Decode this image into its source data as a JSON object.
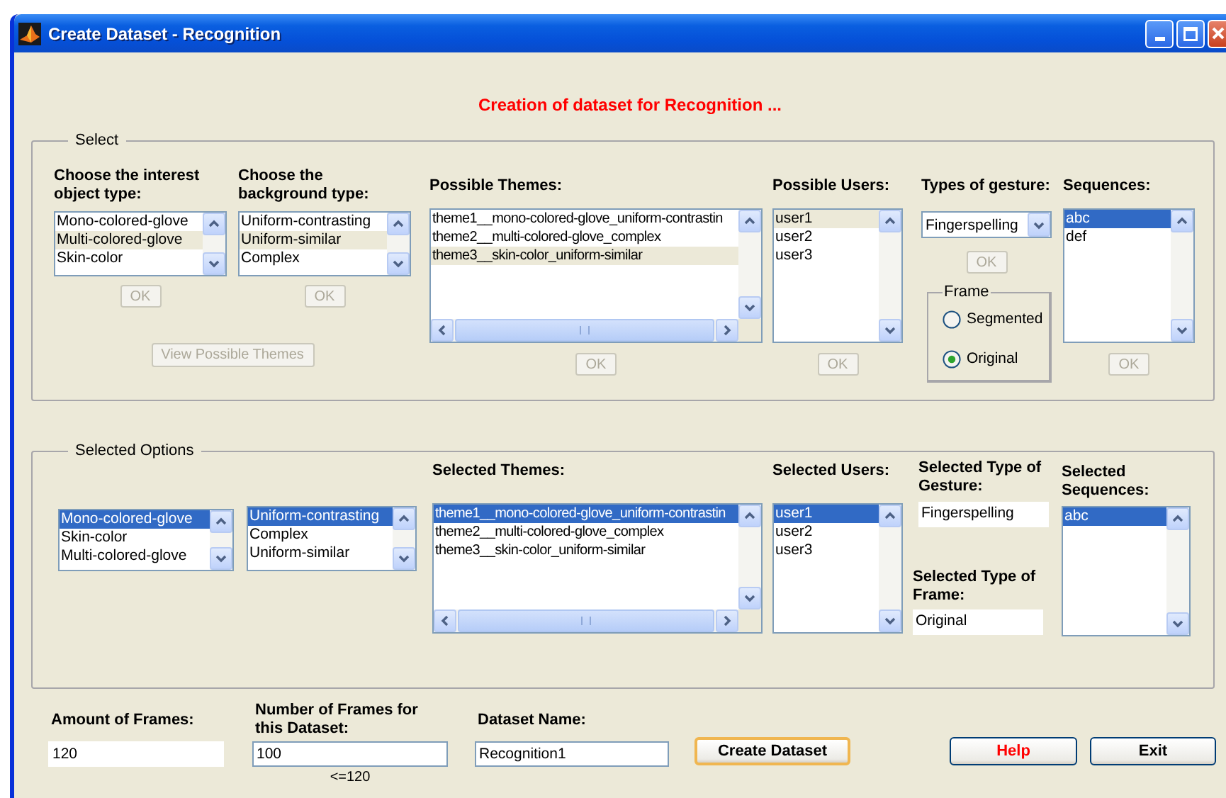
{
  "window": {
    "title": "Create Dataset - Recognition"
  },
  "heading": "Creation of dataset for Recognition  ...",
  "select_panel": {
    "title": "Select",
    "object_type": {
      "label": "Choose the interest object type:",
      "focused": false,
      "items": [
        {
          "text": "Mono-colored-glove",
          "selected": false
        },
        {
          "text": "Multi-colored-glove",
          "selected": true
        },
        {
          "text": "Skin-color",
          "selected": false
        }
      ],
      "ok": {
        "label": "OK",
        "disabled": true
      }
    },
    "background_type": {
      "label": "Choose the background type:",
      "focused": false,
      "items": [
        {
          "text": "Uniform-contrasting",
          "selected": false
        },
        {
          "text": "Uniform-similar",
          "selected": true
        },
        {
          "text": "Complex",
          "selected": false
        }
      ],
      "ok": {
        "label": "OK",
        "disabled": true
      }
    },
    "view_themes_button": {
      "label": "View Possible Themes",
      "disabled": true
    },
    "themes": {
      "label": "Possible Themes:",
      "focused": false,
      "items": [
        {
          "text": "theme1__mono-colored-glove_uniform-contrastin",
          "selected": false
        },
        {
          "text": "theme2__multi-colored-glove_complex",
          "selected": false
        },
        {
          "text": "theme3__skin-color_uniform-similar",
          "selected": true
        }
      ],
      "ok": {
        "label": "OK",
        "disabled": true
      }
    },
    "users": {
      "label": "Possible Users:",
      "focused": false,
      "items": [
        {
          "text": "user1",
          "selected": true
        },
        {
          "text": "user2",
          "selected": false
        },
        {
          "text": "user3",
          "selected": false
        }
      ],
      "ok": {
        "label": "OK",
        "disabled": true
      }
    },
    "gesture": {
      "label": "Types of gesture:",
      "value": "Fingerspelling",
      "ok": {
        "label": "OK",
        "disabled": true
      }
    },
    "frame": {
      "title": "Frame",
      "options": [
        {
          "label": "Segmented",
          "selected": false
        },
        {
          "label": "Original",
          "selected": true
        }
      ]
    },
    "sequences": {
      "label": "Sequences:",
      "focused": true,
      "items": [
        {
          "text": "abc",
          "selected": true
        },
        {
          "text": "def",
          "selected": false
        }
      ],
      "ok": {
        "label": "OK",
        "disabled": true
      }
    }
  },
  "selected_panel": {
    "title": "Selected Options",
    "object_type": {
      "focused": true,
      "items": [
        {
          "text": "Mono-colored-glove",
          "selected": true
        },
        {
          "text": "Skin-color",
          "selected": false
        },
        {
          "text": "Multi-colored-glove",
          "selected": false
        }
      ]
    },
    "background_type": {
      "focused": true,
      "items": [
        {
          "text": "Uniform-contrasting",
          "selected": true
        },
        {
          "text": "Complex",
          "selected": false
        },
        {
          "text": "Uniform-similar",
          "selected": false
        }
      ]
    },
    "themes": {
      "label": "Selected Themes:",
      "focused": true,
      "items": [
        {
          "text": "theme1__mono-colored-glove_uniform-contrastin",
          "selected": true
        },
        {
          "text": "theme2__multi-colored-glove_complex",
          "selected": false
        },
        {
          "text": "theme3__skin-color_uniform-similar",
          "selected": false
        }
      ]
    },
    "users": {
      "label": "Selected Users:",
      "focused": true,
      "items": [
        {
          "text": "user1",
          "selected": true
        },
        {
          "text": "user2",
          "selected": false
        },
        {
          "text": "user3",
          "selected": false
        }
      ]
    },
    "gesture": {
      "label": "Selected Type of Gesture:",
      "value": "Fingerspelling"
    },
    "frame": {
      "label": "Selected Type of Frame:",
      "value": "Original"
    },
    "sequences": {
      "label": "Selected Sequences:",
      "focused": true,
      "items": [
        {
          "text": "abc",
          "selected": true
        }
      ]
    }
  },
  "bottom": {
    "amount": {
      "label": "Amount of Frames:",
      "value": "120"
    },
    "number": {
      "label": "Number of Frames for this Dataset:",
      "value": "100",
      "hint": "<=120"
    },
    "name": {
      "label": "Dataset Name:",
      "value": "Recognition1"
    },
    "buttons": [
      {
        "label": "Create Dataset",
        "kind": "default"
      },
      {
        "label": "Help",
        "kind": "help"
      },
      {
        "label": "Exit",
        "kind": "plain"
      }
    ]
  }
}
